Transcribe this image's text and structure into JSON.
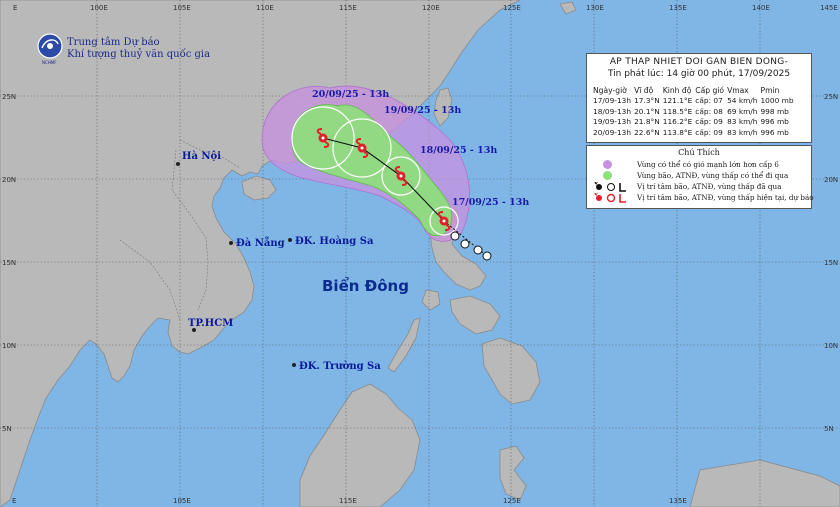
{
  "organization": {
    "line1": "Trung tâm Dự báo",
    "line2": "Khí tượng thuỷ văn quốc gia",
    "logo_caption": "NCHMF"
  },
  "grid": {
    "lon_ticks": [
      "100E",
      "105E",
      "110E",
      "115E",
      "120E",
      "125E",
      "130E",
      "135E",
      "140E",
      "145E"
    ],
    "lat_ticks": [
      "25N",
      "20N",
      "15N",
      "10N",
      "5N"
    ],
    "corner": "E"
  },
  "bulletin": {
    "title": "AP THAP NHIET DOI GAN BIEN DONG-",
    "issued": "Tin phát lúc: 14 giờ 00 phút, 17/09/2025",
    "headers": [
      "Ngày-giờ",
      "Vĩ độ",
      "Kinh độ",
      "Cấp gió",
      "Vmax",
      "Pmin"
    ],
    "rows": [
      [
        "17/09-13h",
        "17.3°N",
        "121.1°E",
        "cấp: 07",
        "54 km/h",
        "1000 mb"
      ],
      [
        "18/09-13h",
        "20.1°N",
        "118.5°E",
        "cấp: 08",
        "69 km/h",
        "998 mb"
      ],
      [
        "19/09-13h",
        "21.8°N",
        "116.2°E",
        "cấp: 09",
        "83 km/h",
        "996 mb"
      ],
      [
        "20/09-13h",
        "22.6°N",
        "113.8°E",
        "cấp: 09",
        "83 km/h",
        "996 mb"
      ]
    ]
  },
  "legend": {
    "title": "Chú Thích",
    "items": [
      {
        "text": "Vùng có thể có gió mạnh lớn hơn cấp 6",
        "color": "#c890e0"
      },
      {
        "text": "Vùng bão, ATNĐ, vùng thấp có thể đi qua",
        "color": "#8ee07a"
      },
      {
        "text": "Vị trí tâm bão, ATNĐ, vùng thấp đã qua",
        "color": "#111111"
      },
      {
        "text": "Vị trí tâm bão, ATNĐ, vùng thấp hiện tại, dự báo",
        "color": "#e0202a"
      }
    ]
  },
  "track_labels": {
    "d17": "17/09/25 - 13h",
    "d18": "18/09/25 - 13h",
    "d19": "19/09/25 - 13h",
    "d20": "20/09/25 - 13h"
  },
  "places": {
    "hanoi": "Hà Nội",
    "danang": "Đà Nẵng",
    "hoangsa": "ĐK. Hoàng Sa",
    "hcm": "TP.HCM",
    "truongsa": "ĐK. Trường Sa",
    "sea": "Biển Đông"
  },
  "colors": {
    "sea": "#7fb6e6",
    "land": "#b8b8b8",
    "wind_zone": "#c890e0",
    "path_zone": "#8ee07a",
    "current_marker": "#e0202a"
  }
}
